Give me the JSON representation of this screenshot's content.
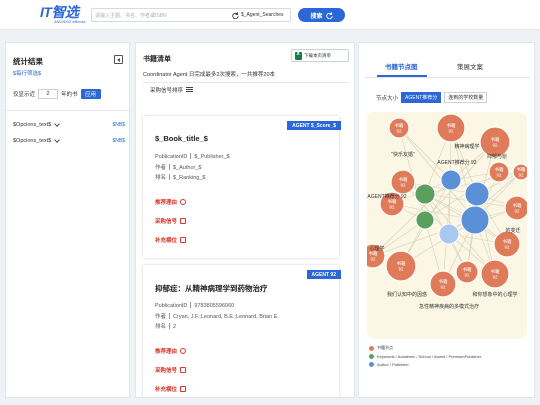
{
  "header": {
    "logo_text": "IT智选",
    "logo_sub": "ANGSKO eBooks",
    "search_placeholder": "请输入主题、书名、作者或ISBN",
    "filter_label": "$_Agent_Searches",
    "search_button": "搜索"
  },
  "left_panel": {
    "title": "统计结果",
    "reset_link": "$每行筛选$",
    "year_prefix": "仅显示近",
    "year_value": "2",
    "year_suffix": "年的书",
    "apply_button": "应用",
    "facets": [
      {
        "label": "$Opcions_text$",
        "count": "$NB$"
      },
      {
        "label": "$Opcions_text$",
        "count": "$NB$"
      }
    ]
  },
  "middle_panel": {
    "title": "书籍清单",
    "download_label": "下载本页清单",
    "summary": "Coordinator Agent 日完成最多2次搜索，一共推荐20本",
    "sort_label": "采购信号排序",
    "cards": [
      {
        "badge": "AGENT $_Score_$",
        "title": "$_Book_title_$",
        "publication_label": "PublicationID",
        "publication_value": "$_Publisher_$",
        "author_label": "作者",
        "author_value": "$_Author_$",
        "rank_label": "排名",
        "rank_value": "$_Ranking_$",
        "actions": [
          "推荐理由",
          "采购信号",
          "补充横位"
        ]
      },
      {
        "badge": "AGENT 92",
        "title": "抑郁症：从精神病理学到药物治疗",
        "publication_label": "PublicationID",
        "publication_value": "9783805596060",
        "author_label": "作者",
        "author_value": "Cryan, J.F.;Leonard, B.E.;Leonard, Brian E.",
        "rank_label": "排名",
        "rank_value": "2",
        "actions": [
          "推荐理由",
          "采购信号",
          "补充横位"
        ]
      }
    ]
  },
  "right_panel": {
    "tabs": [
      "书籍节点图",
      "策展文案"
    ],
    "size_label": "节点大小",
    "size_options": [
      "AGENT推荐分",
      "连到的学校数量"
    ],
    "graph_labels": {
      "node_title": "书籍",
      "node_score": "92",
      "score_text": "AGENT推荐分 92",
      "texts": [
        "\"快乐友婚\"",
        "心理学",
        "我们认知中的因惑",
        "和你想象中的心理学",
        "精神病理学",
        "急性精神疾病的多模式治疗",
        "的变迁",
        "抑郁与愈"
      ]
    },
    "legend": [
      {
        "label": "书籍节点",
        "color": "#e07b5a"
      },
      {
        "label": "Keywords / Academic / School / Award / PremiumPublisher",
        "color": "#5b9f5e"
      },
      {
        "label": "Author / Publisher",
        "color": "#5b8fd6"
      }
    ]
  }
}
